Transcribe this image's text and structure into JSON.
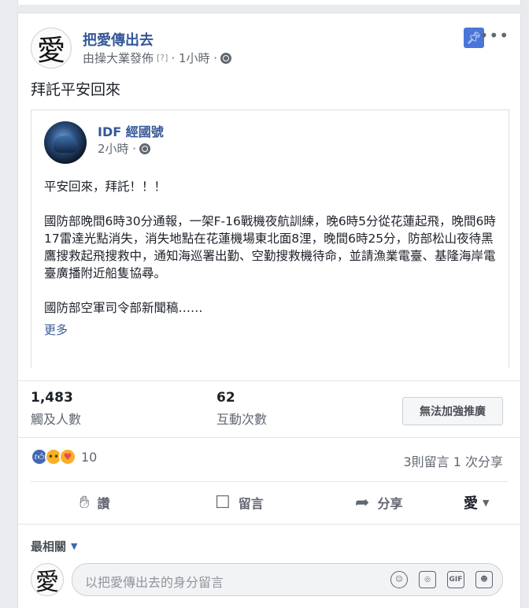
{
  "post": {
    "page_name": "把愛傳出去",
    "avatar_char": "愛",
    "meta_publisher": "由操大業發佈",
    "meta_help": "[?]",
    "meta_time": "· 1小時 ·",
    "text": "拜託平安回來"
  },
  "shared": {
    "name": "IDF 經國號",
    "time": "2小時 ·",
    "paragraphs": [
      "平安回來，拜託！！！",
      "國防部晚間6時30分通報，一架F-16戰機夜航訓練，晚6時5分從花蓮起飛，晚間6時17雷達光點消失，消失地點在花蓮機場東北面8浬，晚間6時25分，防部松山夜待黑鷹搜救起飛搜救中，通知海巡署出勤、空勤搜救機待命，並請漁業電臺、基隆海岸電臺廣播附近船隻協尋。",
      "國防部空軍司令部新聞稿……"
    ],
    "more_label": "更多"
  },
  "stats": {
    "reach_value": "1,483",
    "reach_label": "觸及人數",
    "engagement_value": "62",
    "engagement_label": "互動次數",
    "boost_label": "無法加強推廣"
  },
  "reactions": {
    "count": "10",
    "summary": "3則留言  1 次分享"
  },
  "actions": {
    "like": "讚",
    "comment": "留言",
    "share": "分享",
    "as_page_char": "愛"
  },
  "comments": {
    "sort_label": "最相關",
    "placeholder": "以把愛傳出去的身分留言"
  },
  "icons": {
    "pin": "pin-icon",
    "more": "more-options-icon",
    "globe": "globe-icon",
    "like": "thumbs-up-icon",
    "comment": "speech-bubble-icon",
    "share": "share-arrow-icon",
    "emoji": "emoji-icon",
    "camera": "camera-icon",
    "gif": "gif-icon",
    "sticker": "sticker-icon"
  },
  "colors": {
    "link": "#365899",
    "accent": "#4267b2",
    "muted": "#616770"
  }
}
